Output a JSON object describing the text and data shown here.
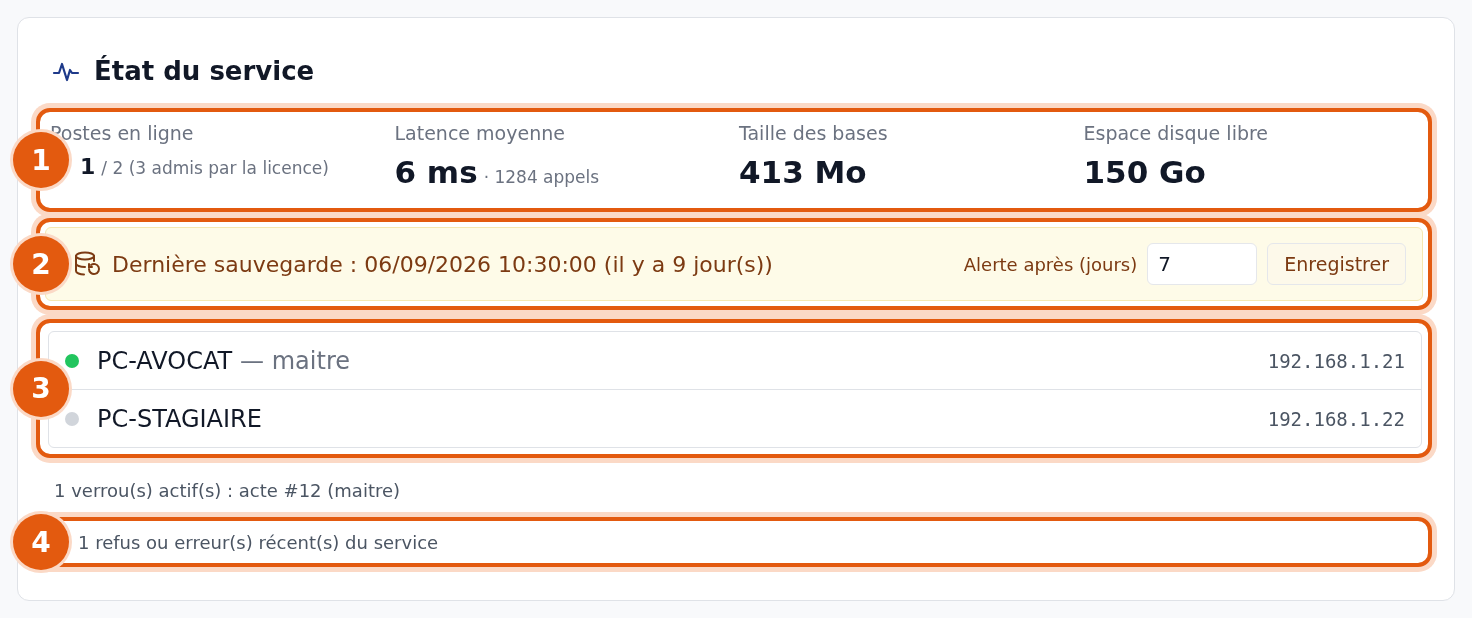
{
  "title": "État du service",
  "stats": {
    "callout": "1",
    "items": [
      {
        "label": "Postes en ligne",
        "value": "1",
        "detail": "/ 2 (3 admis par la licence)",
        "kind": "small"
      },
      {
        "label": "Latence moyenne",
        "value": "6 ms",
        "detail": "· 1284 appels",
        "kind": "big"
      },
      {
        "label": "Taille des bases",
        "value": "413 Mo",
        "kind": "big"
      },
      {
        "label": "Espace disque libre",
        "value": "150 Go",
        "kind": "big"
      }
    ]
  },
  "backup": {
    "callout": "2",
    "text": "Dernière sauvegarde : 06/09/2026 10:30:00 (il y a 9 jour(s))",
    "alert_label": "Alerte après (jours)",
    "alert_value": "7",
    "button": "Enregistrer"
  },
  "stations": {
    "callout": "3",
    "items": [
      {
        "name": "PC-AVOCAT",
        "role": "— maitre",
        "ip": "192.168.1.21",
        "color": "#22c55e"
      },
      {
        "name": "PC-STAGIAIRE",
        "ip": "192.168.1.22",
        "color": "#d1d5db"
      }
    ]
  },
  "locks": "1 verrou(s) actif(s) : acte #12 (maitre)",
  "errors": {
    "callout": "4",
    "text": "1 refus ou erreur(s) récent(s) du service"
  }
}
